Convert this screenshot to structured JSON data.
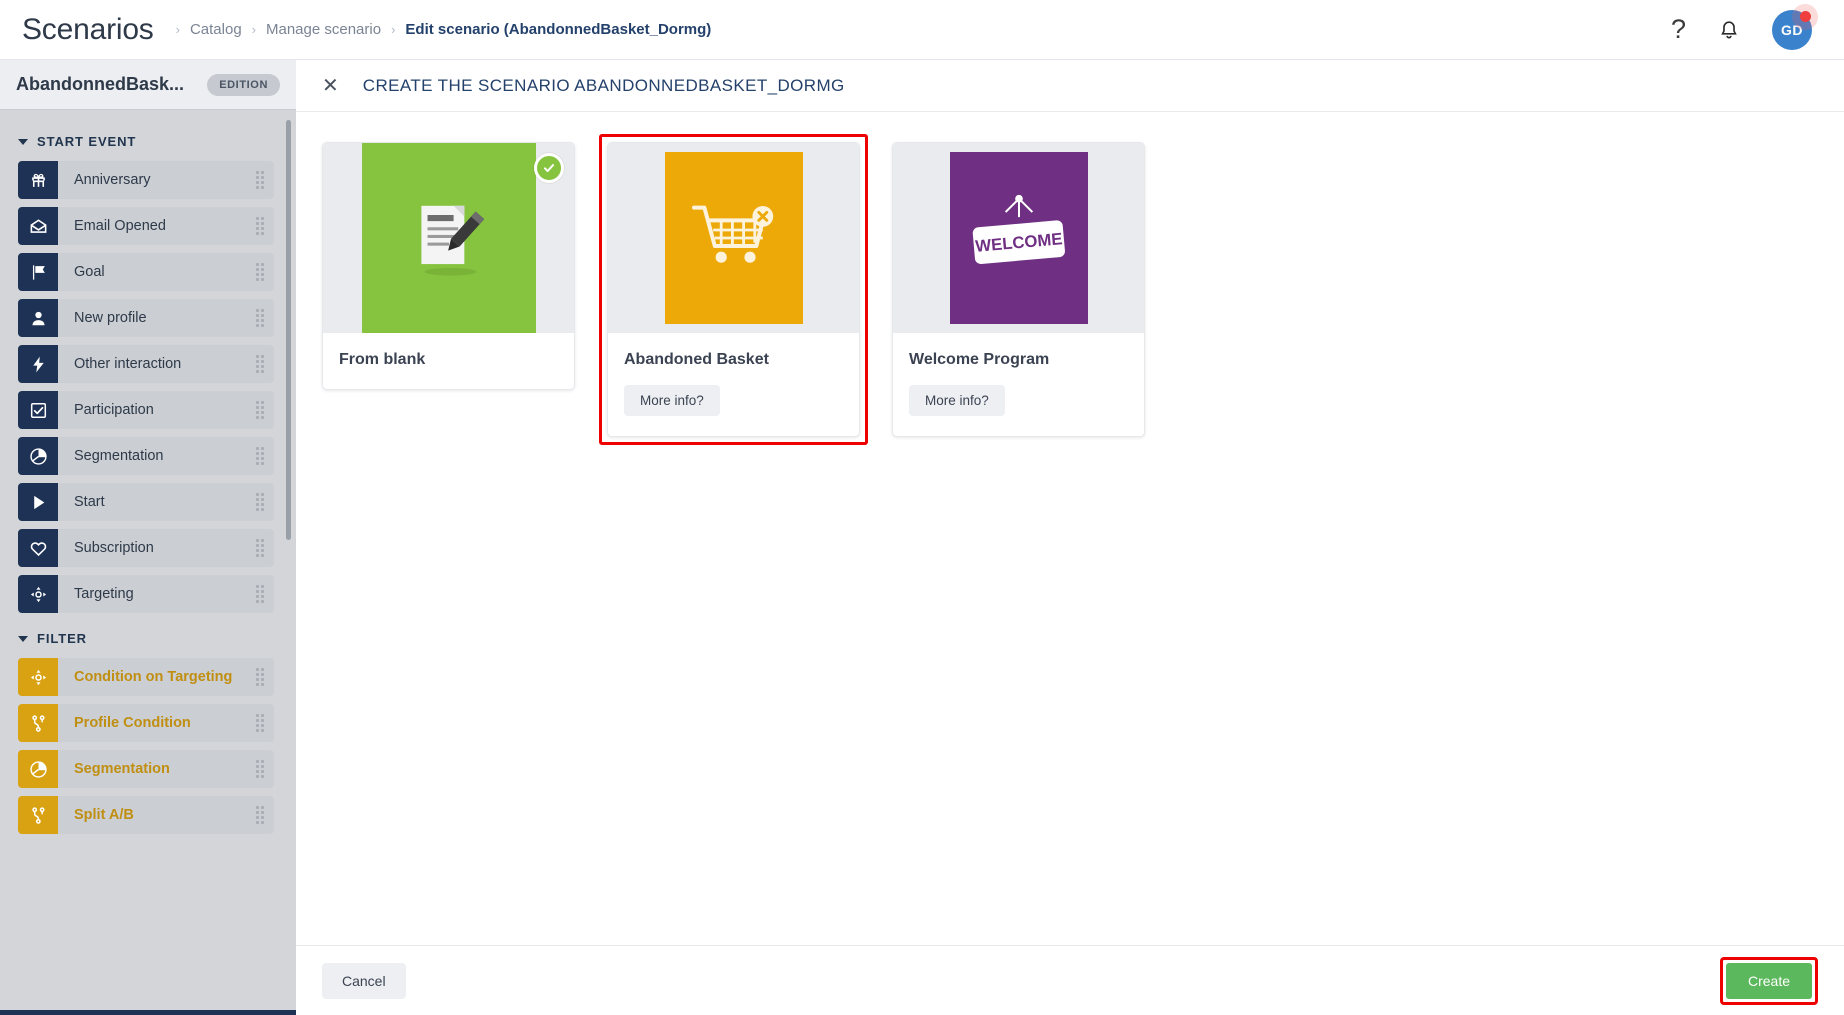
{
  "header": {
    "app_title": "Scenarios",
    "breadcrumbs": [
      {
        "label": "Catalog",
        "active": false
      },
      {
        "label": "Manage scenario",
        "active": false
      },
      {
        "label": "Edit scenario (AbandonnedBasket_Dormg)",
        "active": true
      }
    ],
    "help_icon": "question-mark-icon",
    "bell_icon": "notification-bell-icon",
    "avatar_initials": "GD"
  },
  "sidebar": {
    "scenario_name": "AbandonnedBask...",
    "edition_badge": "EDITION",
    "groups": [
      {
        "title": "START EVENT",
        "kind": "start",
        "items": [
          {
            "label": "Anniversary",
            "icon": "gift-icon"
          },
          {
            "label": "Email Opened",
            "icon": "envelope-open-icon"
          },
          {
            "label": "Goal",
            "icon": "flag-icon"
          },
          {
            "label": "New profile",
            "icon": "person-icon"
          },
          {
            "label": "Other interaction",
            "icon": "lightning-bolt-icon"
          },
          {
            "label": "Participation",
            "icon": "checkbox-checked-icon"
          },
          {
            "label": "Segmentation",
            "icon": "pie-chart-icon"
          },
          {
            "label": "Start",
            "icon": "play-triangle-icon"
          },
          {
            "label": "Subscription",
            "icon": "heart-icon"
          },
          {
            "label": "Targeting",
            "icon": "target-crosshair-icon"
          }
        ]
      },
      {
        "title": "FILTER",
        "kind": "filter",
        "items": [
          {
            "label": "Condition on Targeting",
            "icon": "target-crosshair-icon"
          },
          {
            "label": "Profile Condition",
            "icon": "branch-icon"
          },
          {
            "label": "Segmentation",
            "icon": "pie-chart-icon"
          },
          {
            "label": "Split A/B",
            "icon": "branch-icon"
          }
        ]
      }
    ]
  },
  "modal": {
    "close_icon": "close-x-icon",
    "title": "CREATE THE SCENARIO ABANDONNEDBASKET_DORMG",
    "cards": [
      {
        "title": "From blank",
        "icon": "document-pencil-icon",
        "thumb_color": "#86c440",
        "selected": true,
        "has_more_info": false,
        "highlighted": false
      },
      {
        "title": "Abandoned Basket",
        "icon": "shopping-cart-remove-icon",
        "thumb_color": "#eca908",
        "selected": false,
        "has_more_info": true,
        "more_info_label": "More info?",
        "highlighted": true
      },
      {
        "title": "Welcome Program",
        "icon": "welcome-sign-icon",
        "thumb_color": "#6f3083",
        "thumb_text": "WELCOME",
        "selected": false,
        "has_more_info": true,
        "more_info_label": "More info?",
        "highlighted": false
      }
    ],
    "footer": {
      "cancel_label": "Cancel",
      "create_label": "Create"
    }
  },
  "colors": {
    "accent_navy": "#1d3254",
    "filter_gold": "#d8a213",
    "green": "#86c440",
    "orange": "#eca908",
    "purple": "#6f3083",
    "annotation_red": "#ee0000",
    "create_green": "#5cb85c"
  }
}
